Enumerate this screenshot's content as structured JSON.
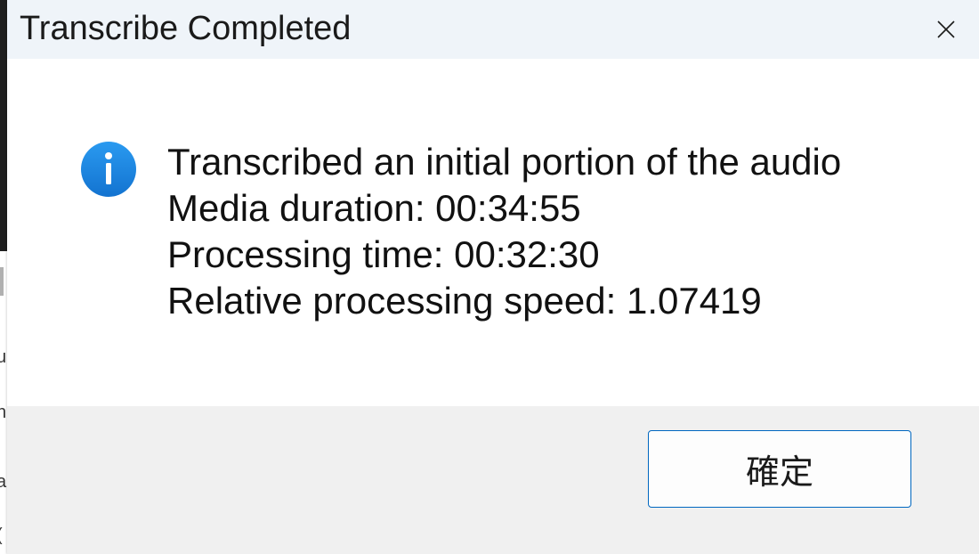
{
  "dialog": {
    "title": "Transcribe Completed",
    "close_icon": "close-icon",
    "info_icon": "info-icon",
    "message_lines": [
      "Transcribed an initial portion of the audio",
      "Media duration: 00:34:55",
      "Processing time: 00:32:30",
      "Relative processing speed: 1.07419"
    ],
    "ok_label": "確定"
  },
  "background_app": {
    "fragments": [
      "u",
      "n",
      "a",
      "("
    ]
  },
  "colors": {
    "title_bar": "#eff4f9",
    "accent": "#0067c0",
    "info_icon": "#1e88e5",
    "footer": "#f0f0f0"
  }
}
